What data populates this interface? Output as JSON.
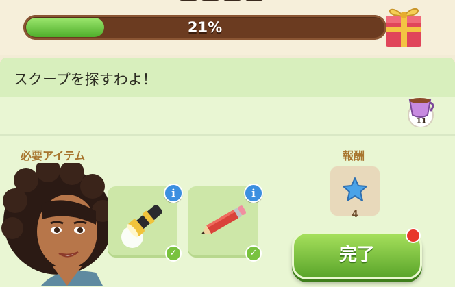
{
  "progress": {
    "percent_label": "21%",
    "fraction": 0.21
  },
  "gift_icon": "gift-box-icon",
  "quest": {
    "title": "スクープを探すわよ！",
    "cup_count": "11",
    "cup_icon": "purple-cup-icon"
  },
  "requirements": {
    "label": "必要アイテム",
    "items": [
      {
        "icon": "flashlight-icon",
        "info": "i",
        "check": "✓"
      },
      {
        "icon": "pencil-icon",
        "info": "i",
        "check": "✓"
      }
    ]
  },
  "reward": {
    "label": "報酬",
    "icon": "blue-star-icon",
    "count": "4"
  },
  "complete_button": {
    "label": "完了"
  },
  "colors": {
    "progress_green": "#5dbb35",
    "track_brown": "#6b3b20",
    "panel_green": "#e9f6d3",
    "label_brown": "#a8762f"
  }
}
